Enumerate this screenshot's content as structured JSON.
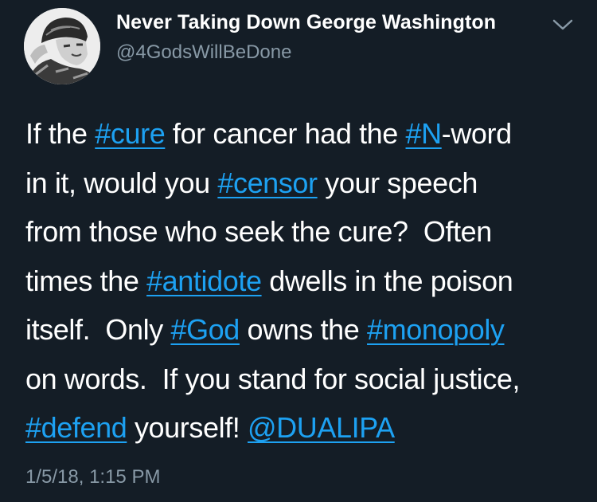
{
  "author": {
    "display_name": "Never Taking Down George Washington",
    "handle": "@4GodsWillBeDone",
    "avatar_icon": "profile-photo-icon",
    "menu_icon": "chevron-down-icon"
  },
  "tweet": {
    "lines": [
      [
        {
          "text": "If the ",
          "type": "text"
        },
        {
          "text": "#cure",
          "type": "hashtag"
        },
        {
          "text": " for cancer had the ",
          "type": "text"
        },
        {
          "text": "#N",
          "type": "hashtag"
        },
        {
          "text": "-word",
          "type": "text"
        }
      ],
      [
        {
          "text": "in it, would you ",
          "type": "text"
        },
        {
          "text": "#censor",
          "type": "hashtag"
        },
        {
          "text": " your speech",
          "type": "text"
        }
      ],
      [
        {
          "text": "from those who seek the cure?  Often",
          "type": "text"
        }
      ],
      [
        {
          "text": "times the ",
          "type": "text"
        },
        {
          "text": "#antidote",
          "type": "hashtag"
        },
        {
          "text": " dwells in the poison",
          "type": "text"
        }
      ],
      [
        {
          "text": "itself.  Only ",
          "type": "text"
        },
        {
          "text": "#God",
          "type": "hashtag"
        },
        {
          "text": " owns the ",
          "type": "text"
        },
        {
          "text": "#monopoly",
          "type": "hashtag"
        }
      ],
      [
        {
          "text": "on words.  If you stand for social justice,",
          "type": "text"
        }
      ],
      [
        {
          "text": "#defend",
          "type": "hashtag"
        },
        {
          "text": " yourself! ",
          "type": "text"
        },
        {
          "text": "@DUALIPA",
          "type": "mention"
        }
      ]
    ],
    "timestamp": "1/5/18, 1:15 PM"
  },
  "colors": {
    "background": "#141d26",
    "link": "#1da1f2",
    "secondary_text": "#8899a6",
    "primary_text": "#ffffff"
  }
}
